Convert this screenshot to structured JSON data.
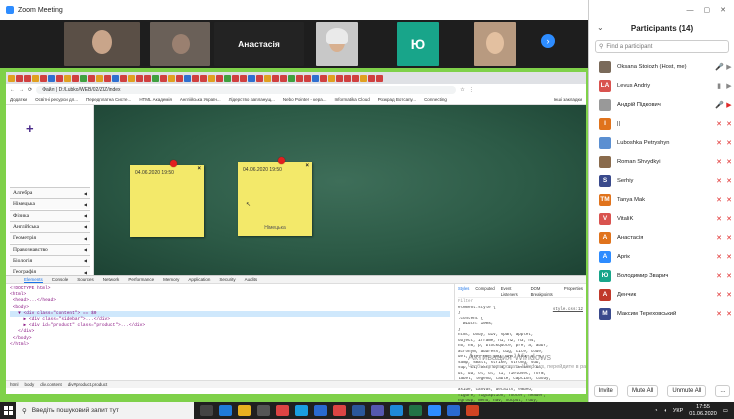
{
  "window": {
    "title": "Zoom Meeting"
  },
  "video_strip": {
    "tile_name": "Анастасія",
    "tile_letter": "Ю"
  },
  "browser": {
    "url": "D:/Lubko/WEB/02/ZIZ/index",
    "back_label": "Файл",
    "bookmarks": [
      "Додатки",
      "Освітні ресурси дл...",
      "Передплатна Систе...",
      "HTML Академія",
      "Англійська Україн...",
      "Лідерство запланущ...",
      "Nebo Pointer - кера...",
      "Informatika Cloud",
      "Розкрад Вотсапу...",
      "Connecting"
    ],
    "other_bookmarks": "Інші закладки"
  },
  "subjects": [
    "Алгебра",
    "Німецька",
    "Фізика",
    "Англійська",
    "Геометрія",
    "Правознавство",
    "Біологія",
    "Географія",
    "Історія України",
    "Всесвітня історія"
  ],
  "notes": [
    {
      "date": "04.06.2020 19:50",
      "close": "×",
      "body": ""
    },
    {
      "date": "04.06.2020 19:50",
      "close": "×",
      "body": "Німецька"
    }
  ],
  "devtools": {
    "tabs": [
      "Elements",
      "Console",
      "Sources",
      "Network",
      "Performance",
      "Memory",
      "Application",
      "Security",
      "Audits"
    ],
    "code_lines": [
      "<!DOCTYPE html>",
      "<html>",
      " <head>...</head>",
      " <body>",
      "   ▼ <div class=\"content\"> == $0",
      "     ▶ <div class=\"sidebar\">...</div>",
      "     ▶ <div id=\"product\" class=\"product\">...</div>",
      "   </div>",
      " </body>",
      "</html>"
    ],
    "style_tabs": [
      "Styles",
      "Computed",
      "Event Listeners",
      "DOM Breakpoints",
      "Properties"
    ],
    "style_filter": "Filter",
    "style_lines": [
      "element.style {",
      "}",
      ".content {",
      "  width: 100%;",
      "}",
      "html, body, div, span, applet,",
      "object, iframe, h1, h2, h3, h4,",
      "h5, h6, p, blockquote, pre, a, abbr,",
      "acronym, address, big, cite, code,",
      "del, dfn, em, img, ins, kbd, q, s,",
      "samp, small, strike, strong, sub,",
      "sup, tt, var, b, u, i, center, dl,",
      "dt, dd, ol, ul, li, fieldset, form,",
      "label, legend, table, caption, tbody,",
      "tfoot, thead, tr, th, td, article,",
      "aside, canvas, details, embed,",
      "figure, figcaption, footer, header,",
      "hgroup, menu, nav, output, ruby,"
    ],
    "style_source": "style.css:12",
    "breadcrumb": [
      "html",
      "body",
      "div.content",
      "div#product.product"
    ]
  },
  "watermark": {
    "line1": "Активация Windows",
    "line2": "Чтобы активировать Windows, перейдите в раздел \"Настройки\"."
  },
  "participants": {
    "title": "Participants (14)",
    "search_placeholder": "Find a participant",
    "list": [
      {
        "name": "Oksana Stoiozh (Host, me)",
        "initial": "",
        "color": "#7a6a5a",
        "mic": "🎤",
        "cam": "▶",
        "mic_red": false,
        "cam_red": false
      },
      {
        "name": "Levus Andriy",
        "initial": "LA",
        "color": "#d9534f",
        "mic": "▮",
        "cam": "▶",
        "mic_red": false,
        "cam_red": false
      },
      {
        "name": "Андрій Підкович",
        "initial": "",
        "color": "#999999",
        "mic": "🎤",
        "cam": "▶",
        "mic_red": false,
        "cam_red": true
      },
      {
        "name": "||",
        "initial": "I",
        "color": "#e0731c",
        "mic": "✕",
        "cam": "✕",
        "mic_red": true,
        "cam_red": true
      },
      {
        "name": "Luboshka Petryshyn",
        "initial": "",
        "color": "#5b8fd1",
        "mic": "✕",
        "cam": "✕",
        "mic_red": true,
        "cam_red": true
      },
      {
        "name": "Roman Shvydkyi",
        "initial": "",
        "color": "#8a6b4c",
        "mic": "✕",
        "cam": "✕",
        "mic_red": true,
        "cam_red": true
      },
      {
        "name": "Serhiy",
        "initial": "S",
        "color": "#3a4a8c",
        "mic": "✕",
        "cam": "✕",
        "mic_red": true,
        "cam_red": true
      },
      {
        "name": "Tanya Mak",
        "initial": "TM",
        "color": "#e0731c",
        "mic": "✕",
        "cam": "✕",
        "mic_red": true,
        "cam_red": true
      },
      {
        "name": "VitaliK",
        "initial": "V",
        "color": "#d9534f",
        "mic": "✕",
        "cam": "✕",
        "mic_red": true,
        "cam_red": true
      },
      {
        "name": "Анастасія",
        "initial": "A",
        "color": "#e0731c",
        "mic": "✕",
        "cam": "✕",
        "mic_red": true,
        "cam_red": true
      },
      {
        "name": "Apriк",
        "initial": "A",
        "color": "#2d8cff",
        "mic": "✕",
        "cam": "✕",
        "mic_red": true,
        "cam_red": true
      },
      {
        "name": "Володимир Зварич",
        "initial": "Ю",
        "color": "#18a58a",
        "mic": "✕",
        "cam": "✕",
        "mic_red": true,
        "cam_red": true
      },
      {
        "name": "Денчик",
        "initial": "A",
        "color": "#c0392b",
        "mic": "✕",
        "cam": "✕",
        "mic_red": true,
        "cam_red": true
      },
      {
        "name": "Максим Тереховський",
        "initial": "M",
        "color": "#3a4a8c",
        "mic": "✕",
        "cam": "✕",
        "mic_red": true,
        "cam_red": true
      }
    ],
    "footer": [
      "Invite",
      "Mute All",
      "Unmute All",
      "..."
    ]
  },
  "taskbar": {
    "search_placeholder": "Введіть пошуковий запит тут",
    "lang": "УКР",
    "time": "17:55",
    "date": "01.06.2020"
  },
  "colors": {
    "accent": "#2d8cff",
    "share_border": "#7fd14a",
    "board": "#2c5a46",
    "note": "#f3e96a",
    "pin": "#e02020"
  }
}
